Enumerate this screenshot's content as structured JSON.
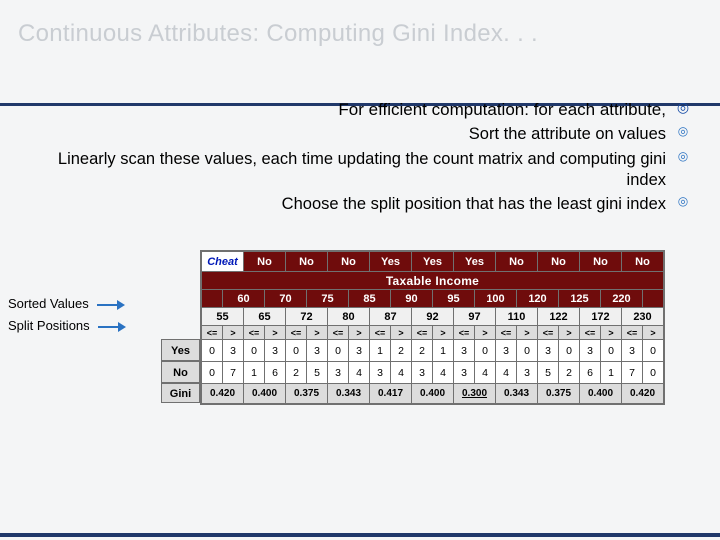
{
  "title": "Continuous Attributes: Computing Gini Index. . .",
  "bullets": {
    "b0": "For efficient computation: for each attribute,",
    "b1": "Sort the attribute on values",
    "b2": "Linearly scan these values, each time updating the count matrix and computing gini index",
    "b3": "Choose the split position that has the least gini index"
  },
  "marks": {
    "l0": "◎",
    "l1": "◎"
  },
  "side": {
    "sorted": "Sorted Values",
    "split": "Split Positions"
  },
  "table": {
    "cheat_label": "Cheat",
    "taxable": "Taxable Income",
    "yes_label": "Yes",
    "no_label": "No",
    "gini_label": "Gini",
    "le": "<=",
    "gt": ">",
    "class_row": [
      "No",
      "No",
      "No",
      "Yes",
      "Yes",
      "Yes",
      "No",
      "No",
      "No",
      "No"
    ],
    "sorted": [
      "60",
      "70",
      "75",
      "85",
      "90",
      "95",
      "100",
      "120",
      "125",
      "220"
    ],
    "splits": [
      "55",
      "65",
      "72",
      "80",
      "87",
      "92",
      "97",
      "110",
      "122",
      "172",
      "230"
    ],
    "yes_counts": [
      [
        "0",
        "3"
      ],
      [
        "0",
        "3"
      ],
      [
        "0",
        "3"
      ],
      [
        "0",
        "3"
      ],
      [
        "1",
        "2"
      ],
      [
        "2",
        "1"
      ],
      [
        "3",
        "0"
      ],
      [
        "3",
        "0"
      ],
      [
        "3",
        "0"
      ],
      [
        "3",
        "0"
      ],
      [
        "3",
        "0"
      ]
    ],
    "no_counts": [
      [
        "0",
        "7"
      ],
      [
        "1",
        "6"
      ],
      [
        "2",
        "5"
      ],
      [
        "3",
        "4"
      ],
      [
        "3",
        "4"
      ],
      [
        "3",
        "4"
      ],
      [
        "3",
        "4"
      ],
      [
        "4",
        "3"
      ],
      [
        "5",
        "2"
      ],
      [
        "6",
        "1"
      ],
      [
        "7",
        "0"
      ]
    ],
    "gini": [
      "0.420",
      "0.400",
      "0.375",
      "0.343",
      "0.417",
      "0.400",
      "0.300",
      "0.343",
      "0.375",
      "0.400",
      "0.420"
    ],
    "gini_best_idx": 6
  }
}
